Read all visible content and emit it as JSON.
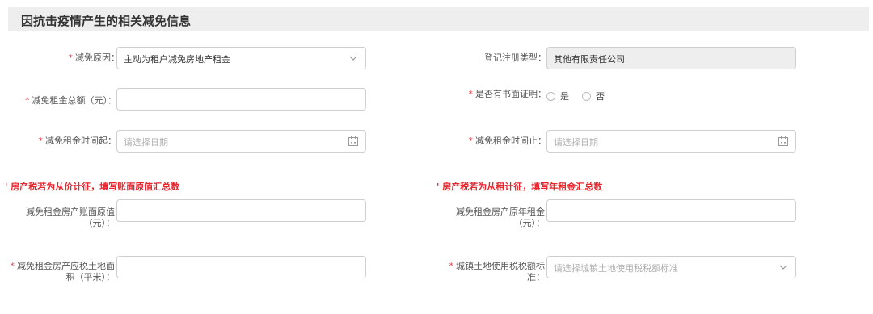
{
  "section": {
    "title": "因抗击疫情产生的相关减免信息"
  },
  "required_mark": "*",
  "fields": {
    "reason": {
      "label": "减免原因：",
      "value": "主动为租户减免房地产租金"
    },
    "reg_type": {
      "label": "登记注册类型：",
      "value": "其他有限责任公司"
    },
    "total_rent": {
      "label": "减免租金总额（元）：",
      "value": ""
    },
    "written_proof": {
      "label": "是否有书面证明：",
      "option_yes": "是",
      "option_no": "否"
    },
    "start_date": {
      "label": "减免租金时间起：",
      "placeholder": "请选择日期"
    },
    "end_date": {
      "label": "减免租金时间止：",
      "placeholder": "请选择日期"
    },
    "book_value": {
      "label": "减免租金房产账面原值（元）：",
      "value": ""
    },
    "annual_rent": {
      "label": "减免租金房产原年租金（元）：",
      "value": ""
    },
    "land_area": {
      "label": "减免租金房产应税土地面积（平米）：",
      "value": ""
    },
    "land_tax_standard": {
      "label": "城镇土地使用税税额标准：",
      "placeholder": "请选择城镇土地使用税税额标准"
    }
  },
  "notes": {
    "left": "' 房产税若为从价计征，填写账面原值汇总数",
    "right": "' 房产税若为从租计征，填写年租金汇总数"
  }
}
